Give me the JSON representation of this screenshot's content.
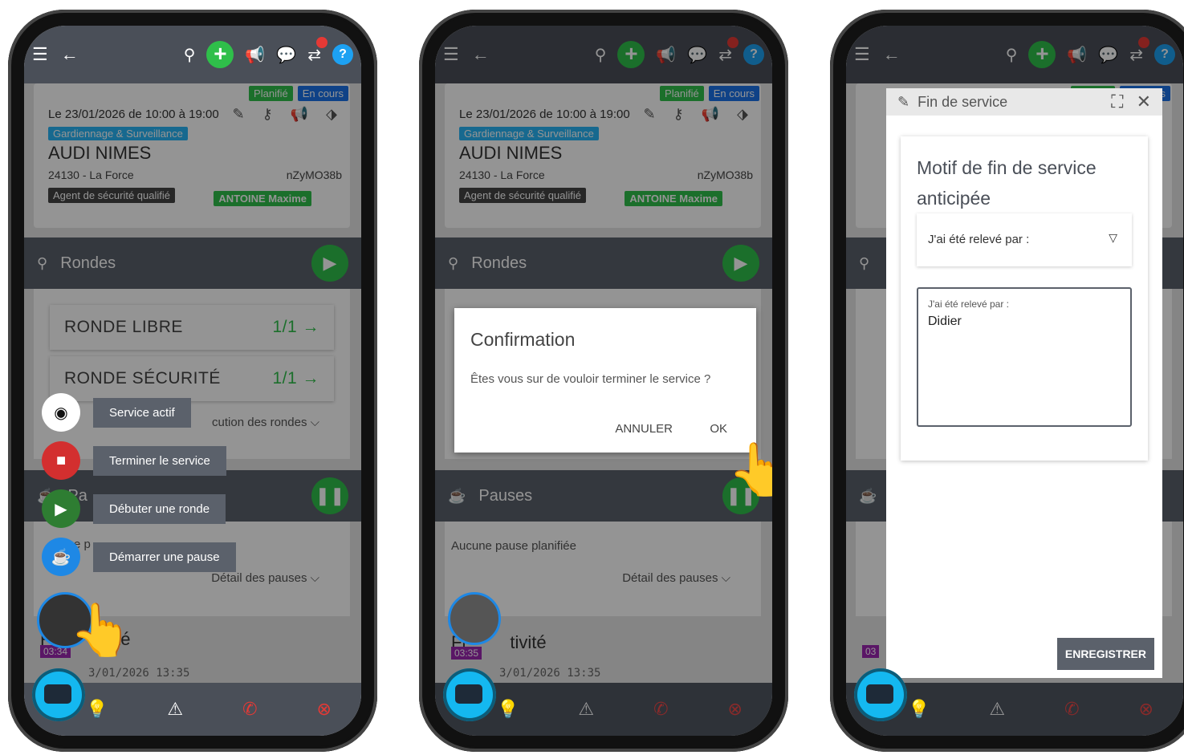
{
  "shift": {
    "date": "Le 23/01/2026 de 10:00 à 19:00",
    "category": "Gardiennage & Surveillance",
    "site": "AUDI NIMES",
    "address": "24130 - La Force",
    "code": "nZyMO38b",
    "role": "Agent de sécurité qualifié",
    "agent": "ANTOINE Maxime",
    "badge_planned": "Planifié",
    "badge_current": "En cours"
  },
  "rondes": {
    "title": "Rondes",
    "items": [
      {
        "name": "RONDE LIBRE",
        "count": "1/1 →"
      },
      {
        "name": "RONDE SÉCURITÉ",
        "count": "1/1 →"
      }
    ],
    "detail": "Détail de l'exécution des rondes",
    "detail_partial": "cution des rondes"
  },
  "pauses": {
    "title": "Pauses",
    "empty": "Aucune pause planifiée",
    "detail": "Détail des pauses",
    "partial_title": "Pa",
    "partial_empty": "e p"
  },
  "activity": {
    "title": "Fin d'activité",
    "title_left": "Fi",
    "title_right": "ivité",
    "title_right2": "tivité",
    "timer1": "03:34",
    "timer2": "03:35",
    "timer3": "03",
    "date": "23/01/2026 13:35",
    "date_partial": "3/01/2026 13:35"
  },
  "fab_menu": [
    {
      "label": "Service actif",
      "color": "#ffffff"
    },
    {
      "label": "Terminer le service",
      "color": "#d32f2f"
    },
    {
      "label": "Débuter une ronde",
      "color": "#2e7d32"
    },
    {
      "label": "Démarrer une pause",
      "color": "#1e88e5"
    }
  ],
  "confirm": {
    "title": "Confirmation",
    "message": "Êtes vous sur de vouloir terminer le service ?",
    "cancel": "ANNULER",
    "ok": "OK"
  },
  "end_modal": {
    "header": "Fin de service",
    "title": "Motif de fin de service anticipée",
    "select_value": "J'ai été relevé par :",
    "field_label": "J'ai été relevé par :",
    "field_value": "Didier",
    "save": "ENREGISTRER"
  }
}
